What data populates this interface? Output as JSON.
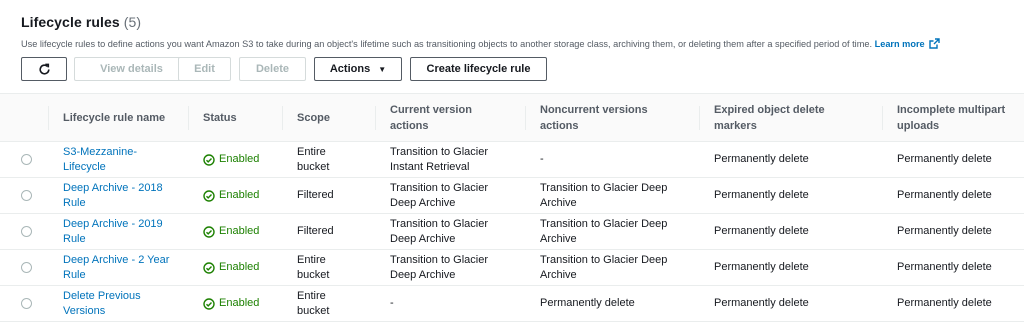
{
  "header": {
    "title": "Lifecycle rules",
    "count": "(5)",
    "description": "Use lifecycle rules to define actions you want Amazon S3 to take during an object's lifetime such as transitioning objects to another storage class, archiving them, or deleting them after a specified period of time.",
    "learn_more": "Learn more"
  },
  "toolbar": {
    "view_details": "View details",
    "edit": "Edit",
    "delete": "Delete",
    "actions": "Actions",
    "create": "Create lifecycle rule"
  },
  "columns": {
    "name": "Lifecycle rule name",
    "status": "Status",
    "scope": "Scope",
    "current_1": "Current version",
    "current_2": "actions",
    "noncurrent_1": "Noncurrent versions",
    "noncurrent_2": "actions",
    "expired_1": "Expired object delete",
    "expired_2": "markers",
    "incomplete_1": "Incomplete multipart",
    "incomplete_2": "uploads"
  },
  "rows": [
    {
      "name_1": "S3-Mezzanine-",
      "name_2": "Lifecycle",
      "status": "Enabled",
      "scope_1": "Entire",
      "scope_2": "bucket",
      "current_1": "Transition to Glacier",
      "current_2": "Instant Retrieval",
      "noncurrent_1": "-",
      "noncurrent_2": "",
      "expired": "Permanently delete",
      "incomplete": "Permanently delete"
    },
    {
      "name_1": "Deep Archive - 2018",
      "name_2": "Rule",
      "status": "Enabled",
      "scope_1": "Filtered",
      "scope_2": "",
      "current_1": "Transition to Glacier",
      "current_2": "Deep Archive",
      "noncurrent_1": "Transition to Glacier Deep",
      "noncurrent_2": "Archive",
      "expired": "Permanently delete",
      "incomplete": "Permanently delete"
    },
    {
      "name_1": "Deep Archive - 2019",
      "name_2": "Rule",
      "status": "Enabled",
      "scope_1": "Filtered",
      "scope_2": "",
      "current_1": "Transition to Glacier",
      "current_2": "Deep Archive",
      "noncurrent_1": "Transition to Glacier Deep",
      "noncurrent_2": "Archive",
      "expired": "Permanently delete",
      "incomplete": "Permanently delete"
    },
    {
      "name_1": "Deep Archive - 2 Year",
      "name_2": "Rule",
      "status": "Enabled",
      "scope_1": "Entire",
      "scope_2": "bucket",
      "current_1": "Transition to Glacier",
      "current_2": "Deep Archive",
      "noncurrent_1": "Transition to Glacier Deep",
      "noncurrent_2": "Archive",
      "expired": "Permanently delete",
      "incomplete": "Permanently delete"
    },
    {
      "name_1": "Delete Previous",
      "name_2": "Versions",
      "status": "Enabled",
      "scope_1": "Entire",
      "scope_2": "bucket",
      "current_1": "-",
      "current_2": "",
      "noncurrent_1": "Permanently delete",
      "noncurrent_2": "",
      "expired": "Permanently delete",
      "incomplete": "Permanently delete"
    }
  ],
  "icons": {
    "refresh": "refresh-icon",
    "external": "external-link-icon",
    "caret": "caret-down-icon",
    "status": "check-circle-icon",
    "radio": "radio-button"
  },
  "colors": {
    "link": "#0073bb",
    "status_ok": "#1d8102",
    "header_bg": "#fafafa",
    "border": "#eaeded"
  }
}
